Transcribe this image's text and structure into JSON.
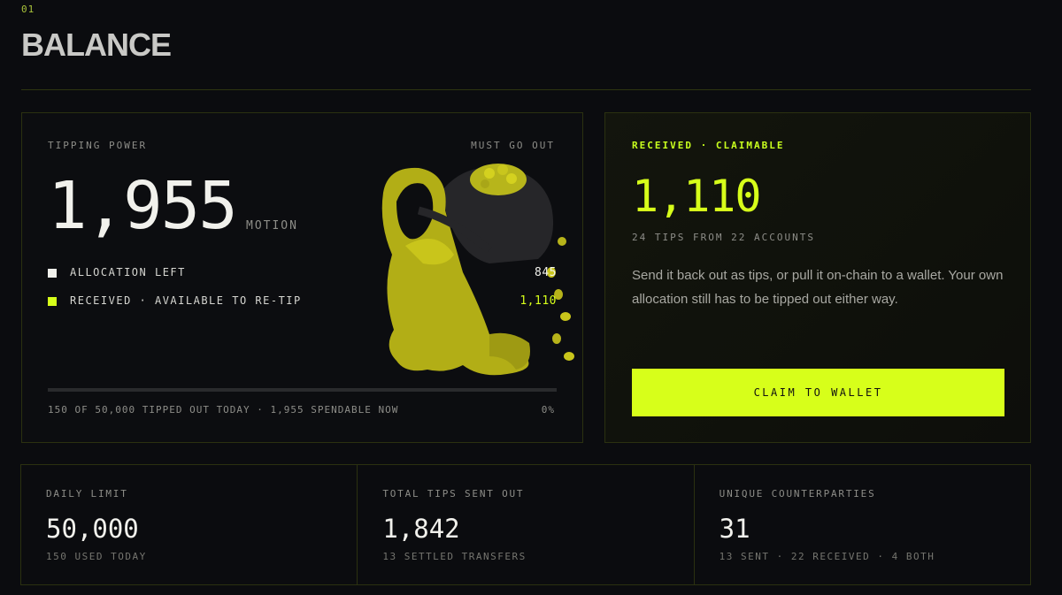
{
  "section": {
    "number": "01",
    "title": "BALANCE"
  },
  "power": {
    "label": "TIPPING POWER",
    "badge": "MUST GO OUT",
    "amount": "1,955",
    "unit": "MOTION",
    "legend": [
      {
        "label": "ALLOCATION LEFT",
        "value": "845",
        "color": "#f1f1ec"
      },
      {
        "label": "RECEIVED · AVAILABLE TO RE-TIP",
        "value": "1,110",
        "color": "#d7ff1a"
      }
    ],
    "progress_percent": 0,
    "footer": "150 OF 50,000 TIPPED OUT TODAY · 1,955 SPENDABLE NOW",
    "percent_label": "0%",
    "mascot_icon": "hooded-figure-coin-sack-illustration"
  },
  "received": {
    "label": "RECEIVED · CLAIMABLE",
    "amount": "1,110",
    "sub": "24 TIPS FROM 22 ACCOUNTS",
    "description": "Send it back out as tips, or pull it on-chain to a wallet. Your own allocation still has to be tipped out either way.",
    "button_label": "CLAIM TO WALLET"
  },
  "stats": [
    {
      "label": "DAILY LIMIT",
      "value": "50,000",
      "sub": "150 USED TODAY"
    },
    {
      "label": "TOTAL TIPS SENT OUT",
      "value": "1,842",
      "sub": "13 SETTLED TRANSFERS"
    },
    {
      "label": "UNIQUE COUNTERPARTIES",
      "value": "31",
      "sub": "13 SENT · 22 RECEIVED · 4 BOTH"
    }
  ],
  "colors": {
    "accent": "#d7ff1a",
    "background": "#0b0c0f",
    "border": "#2b3110"
  }
}
